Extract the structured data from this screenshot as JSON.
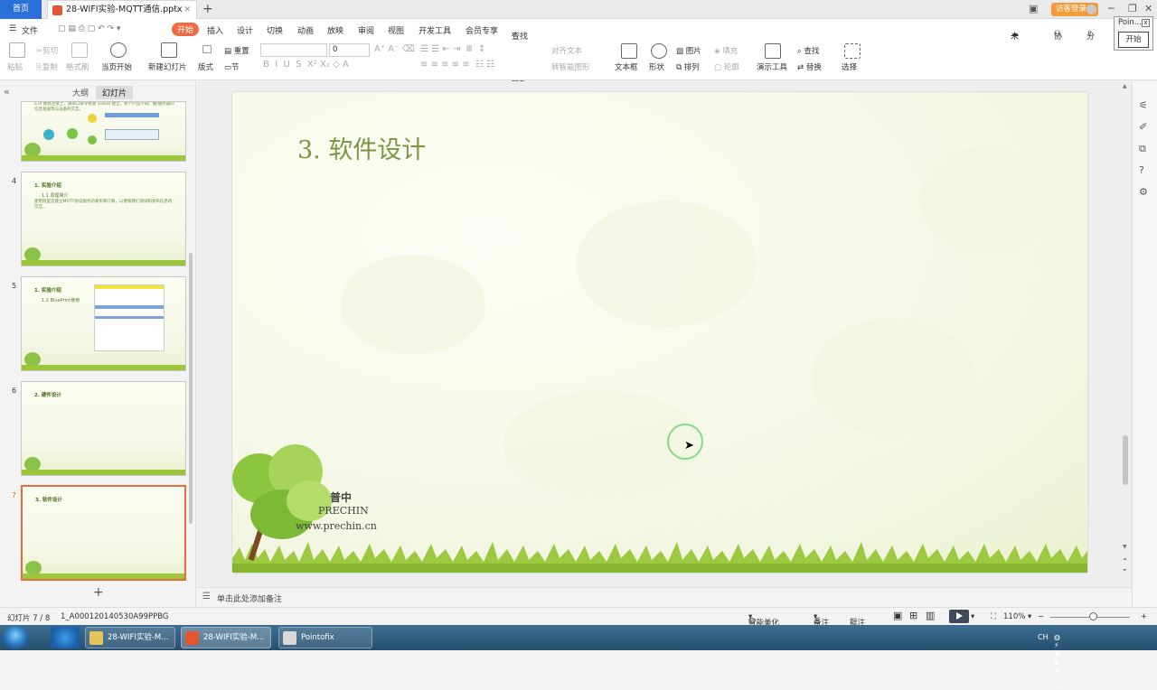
{
  "tabs": {
    "home": "首页",
    "doc_title": "28-WIFI实验-MQTT通信.pptx"
  },
  "titlebar": {
    "login": "访客登录"
  },
  "pointofix": {
    "title": "Poin...",
    "button": "开始"
  },
  "menu": {
    "file": "文件",
    "items": [
      "开始",
      "插入",
      "设计",
      "切换",
      "动画",
      "放映",
      "审阅",
      "视图",
      "开发工具",
      "会员专享"
    ],
    "search_placeholder": "查找命令、搜索模板",
    "sync": "未同步",
    "collab": "协作",
    "share": "分享"
  },
  "ribbon": {
    "paste": "粘贴",
    "cut": "剪切",
    "copy": "复制",
    "format_painter": "格式刷",
    "from_start": "当页开始",
    "new_slide": "新建幻灯片",
    "layout": "版式",
    "section": "节",
    "reset": "重置",
    "font_size": "0",
    "align_text": "对齐文本",
    "smart_art": "转智能图形",
    "textbox": "文本框",
    "shape": "形状",
    "picture": "图片",
    "fill": "填充",
    "arrange": "排列",
    "outline": "轮廓",
    "presentation_tools": "演示工具",
    "find": "查找",
    "replace": "替换",
    "select": "选择"
  },
  "left_panel": {
    "tab_outline": "大纲",
    "tab_slides": "幻灯片",
    "slides": [
      {
        "num": "",
        "title": "",
        "sub": "",
        "body": "STA 模式连接上，请串口命令接收 socket 建立，各个产品不同广播/服务器的信息发送等与设备的交互。"
      },
      {
        "num": "4",
        "title": "1. 实验介绍",
        "sub": "1.1 原理简介",
        "body": "使用阿里云建立MQTT协议服务的发布和订阅，以便和我们测试和发布信息的交互。"
      },
      {
        "num": "5",
        "title": "1. 实验介绍",
        "sub": "1.2 BluePrint使用",
        "body": ""
      },
      {
        "num": "6",
        "title": "2. 硬件设计",
        "sub": "",
        "body": ""
      },
      {
        "num": "7",
        "title": "3. 软件设计",
        "sub": "",
        "body": ""
      }
    ]
  },
  "slide": {
    "title": "3. 软件设计",
    "logo_cn": "普中",
    "logo_en": "PRECHIN",
    "logo_url": "www.prechin.cn"
  },
  "notes": {
    "placeholder": "单击此处添加备注"
  },
  "status": {
    "slide_counter": "幻灯片 7 / 8",
    "theme": "1_A000120140530A99PPBG",
    "beautify": "智能美化",
    "notes": "备注",
    "comments": "批注",
    "zoom": "110%"
  },
  "taskbar": {
    "windows": [
      "28-WIFI实验-M...",
      "28-WIFI实验-M...",
      "Pointofix"
    ]
  }
}
